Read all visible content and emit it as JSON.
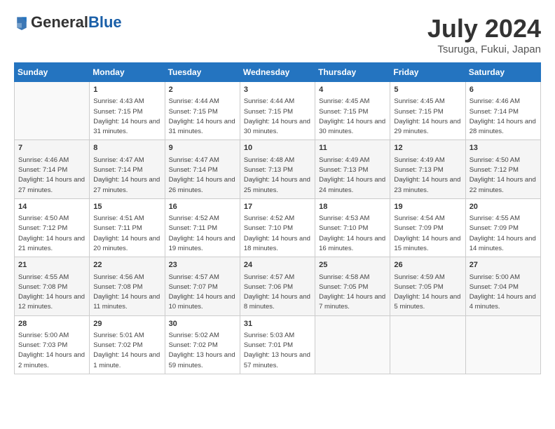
{
  "header": {
    "logo_general": "General",
    "logo_blue": "Blue",
    "month_title": "July 2024",
    "location": "Tsuruga, Fukui, Japan"
  },
  "days_of_week": [
    "Sunday",
    "Monday",
    "Tuesday",
    "Wednesday",
    "Thursday",
    "Friday",
    "Saturday"
  ],
  "weeks": [
    [
      {
        "day": "",
        "sunrise": "",
        "sunset": "",
        "daylight": ""
      },
      {
        "day": "1",
        "sunrise": "Sunrise: 4:43 AM",
        "sunset": "Sunset: 7:15 PM",
        "daylight": "Daylight: 14 hours and 31 minutes."
      },
      {
        "day": "2",
        "sunrise": "Sunrise: 4:44 AM",
        "sunset": "Sunset: 7:15 PM",
        "daylight": "Daylight: 14 hours and 31 minutes."
      },
      {
        "day": "3",
        "sunrise": "Sunrise: 4:44 AM",
        "sunset": "Sunset: 7:15 PM",
        "daylight": "Daylight: 14 hours and 30 minutes."
      },
      {
        "day": "4",
        "sunrise": "Sunrise: 4:45 AM",
        "sunset": "Sunset: 7:15 PM",
        "daylight": "Daylight: 14 hours and 30 minutes."
      },
      {
        "day": "5",
        "sunrise": "Sunrise: 4:45 AM",
        "sunset": "Sunset: 7:15 PM",
        "daylight": "Daylight: 14 hours and 29 minutes."
      },
      {
        "day": "6",
        "sunrise": "Sunrise: 4:46 AM",
        "sunset": "Sunset: 7:14 PM",
        "daylight": "Daylight: 14 hours and 28 minutes."
      }
    ],
    [
      {
        "day": "7",
        "sunrise": "Sunrise: 4:46 AM",
        "sunset": "Sunset: 7:14 PM",
        "daylight": "Daylight: 14 hours and 27 minutes."
      },
      {
        "day": "8",
        "sunrise": "Sunrise: 4:47 AM",
        "sunset": "Sunset: 7:14 PM",
        "daylight": "Daylight: 14 hours and 27 minutes."
      },
      {
        "day": "9",
        "sunrise": "Sunrise: 4:47 AM",
        "sunset": "Sunset: 7:14 PM",
        "daylight": "Daylight: 14 hours and 26 minutes."
      },
      {
        "day": "10",
        "sunrise": "Sunrise: 4:48 AM",
        "sunset": "Sunset: 7:13 PM",
        "daylight": "Daylight: 14 hours and 25 minutes."
      },
      {
        "day": "11",
        "sunrise": "Sunrise: 4:49 AM",
        "sunset": "Sunset: 7:13 PM",
        "daylight": "Daylight: 14 hours and 24 minutes."
      },
      {
        "day": "12",
        "sunrise": "Sunrise: 4:49 AM",
        "sunset": "Sunset: 7:13 PM",
        "daylight": "Daylight: 14 hours and 23 minutes."
      },
      {
        "day": "13",
        "sunrise": "Sunrise: 4:50 AM",
        "sunset": "Sunset: 7:12 PM",
        "daylight": "Daylight: 14 hours and 22 minutes."
      }
    ],
    [
      {
        "day": "14",
        "sunrise": "Sunrise: 4:50 AM",
        "sunset": "Sunset: 7:12 PM",
        "daylight": "Daylight: 14 hours and 21 minutes."
      },
      {
        "day": "15",
        "sunrise": "Sunrise: 4:51 AM",
        "sunset": "Sunset: 7:11 PM",
        "daylight": "Daylight: 14 hours and 20 minutes."
      },
      {
        "day": "16",
        "sunrise": "Sunrise: 4:52 AM",
        "sunset": "Sunset: 7:11 PM",
        "daylight": "Daylight: 14 hours and 19 minutes."
      },
      {
        "day": "17",
        "sunrise": "Sunrise: 4:52 AM",
        "sunset": "Sunset: 7:10 PM",
        "daylight": "Daylight: 14 hours and 18 minutes."
      },
      {
        "day": "18",
        "sunrise": "Sunrise: 4:53 AM",
        "sunset": "Sunset: 7:10 PM",
        "daylight": "Daylight: 14 hours and 16 minutes."
      },
      {
        "day": "19",
        "sunrise": "Sunrise: 4:54 AM",
        "sunset": "Sunset: 7:09 PM",
        "daylight": "Daylight: 14 hours and 15 minutes."
      },
      {
        "day": "20",
        "sunrise": "Sunrise: 4:55 AM",
        "sunset": "Sunset: 7:09 PM",
        "daylight": "Daylight: 14 hours and 14 minutes."
      }
    ],
    [
      {
        "day": "21",
        "sunrise": "Sunrise: 4:55 AM",
        "sunset": "Sunset: 7:08 PM",
        "daylight": "Daylight: 14 hours and 12 minutes."
      },
      {
        "day": "22",
        "sunrise": "Sunrise: 4:56 AM",
        "sunset": "Sunset: 7:08 PM",
        "daylight": "Daylight: 14 hours and 11 minutes."
      },
      {
        "day": "23",
        "sunrise": "Sunrise: 4:57 AM",
        "sunset": "Sunset: 7:07 PM",
        "daylight": "Daylight: 14 hours and 10 minutes."
      },
      {
        "day": "24",
        "sunrise": "Sunrise: 4:57 AM",
        "sunset": "Sunset: 7:06 PM",
        "daylight": "Daylight: 14 hours and 8 minutes."
      },
      {
        "day": "25",
        "sunrise": "Sunrise: 4:58 AM",
        "sunset": "Sunset: 7:05 PM",
        "daylight": "Daylight: 14 hours and 7 minutes."
      },
      {
        "day": "26",
        "sunrise": "Sunrise: 4:59 AM",
        "sunset": "Sunset: 7:05 PM",
        "daylight": "Daylight: 14 hours and 5 minutes."
      },
      {
        "day": "27",
        "sunrise": "Sunrise: 5:00 AM",
        "sunset": "Sunset: 7:04 PM",
        "daylight": "Daylight: 14 hours and 4 minutes."
      }
    ],
    [
      {
        "day": "28",
        "sunrise": "Sunrise: 5:00 AM",
        "sunset": "Sunset: 7:03 PM",
        "daylight": "Daylight: 14 hours and 2 minutes."
      },
      {
        "day": "29",
        "sunrise": "Sunrise: 5:01 AM",
        "sunset": "Sunset: 7:02 PM",
        "daylight": "Daylight: 14 hours and 1 minute."
      },
      {
        "day": "30",
        "sunrise": "Sunrise: 5:02 AM",
        "sunset": "Sunset: 7:02 PM",
        "daylight": "Daylight: 13 hours and 59 minutes."
      },
      {
        "day": "31",
        "sunrise": "Sunrise: 5:03 AM",
        "sunset": "Sunset: 7:01 PM",
        "daylight": "Daylight: 13 hours and 57 minutes."
      },
      {
        "day": "",
        "sunrise": "",
        "sunset": "",
        "daylight": ""
      },
      {
        "day": "",
        "sunrise": "",
        "sunset": "",
        "daylight": ""
      },
      {
        "day": "",
        "sunrise": "",
        "sunset": "",
        "daylight": ""
      }
    ]
  ]
}
